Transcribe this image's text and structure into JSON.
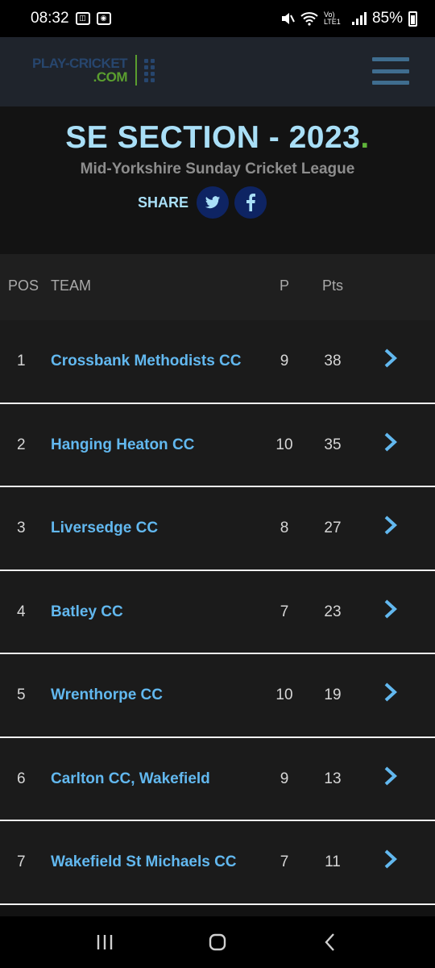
{
  "status_bar": {
    "time": "08:32",
    "battery": "85%",
    "network": "Vo) LTE1",
    "left_icons": [
      "notification-icon",
      "alarm-icon"
    ],
    "right_icons": [
      "mute-icon",
      "wifi-icon",
      "signal-icon",
      "battery-icon"
    ]
  },
  "header": {
    "logo_top": "PLAY-CRICKET",
    "logo_bottom": ".COM",
    "menu_icon": "hamburger-menu-icon"
  },
  "hero": {
    "title": "SE SECTION - 2023",
    "title_dot": ".",
    "subtitle": "Mid-Yorkshire Sunday Cricket League",
    "share_label": "SHARE",
    "share_buttons": [
      "twitter-icon",
      "facebook-icon"
    ]
  },
  "table": {
    "headers": {
      "pos": "POS",
      "team": "TEAM",
      "p": "P",
      "pts": "Pts"
    },
    "rows": [
      {
        "pos": "1",
        "team": "Crossbank Methodists CC",
        "p": "9",
        "pts": "38"
      },
      {
        "pos": "2",
        "team": "Hanging Heaton CC",
        "p": "10",
        "pts": "35"
      },
      {
        "pos": "3",
        "team": "Liversedge CC",
        "p": "8",
        "pts": "27"
      },
      {
        "pos": "4",
        "team": "Batley CC",
        "p": "7",
        "pts": "23"
      },
      {
        "pos": "5",
        "team": "Wrenthorpe CC",
        "p": "10",
        "pts": "19"
      },
      {
        "pos": "6",
        "team": "Carlton CC, Wakefield",
        "p": "9",
        "pts": "13"
      },
      {
        "pos": "7",
        "team": "Wakefield St Michaels CC",
        "p": "7",
        "pts": "11"
      }
    ]
  },
  "nav_bar": {
    "buttons": [
      "recents-icon",
      "home-icon",
      "back-icon"
    ]
  },
  "colors": {
    "title": "#a9dff7",
    "accent_green": "#5fb43a",
    "team_link": "#62b8ef",
    "social_bg": "#0e2463"
  }
}
